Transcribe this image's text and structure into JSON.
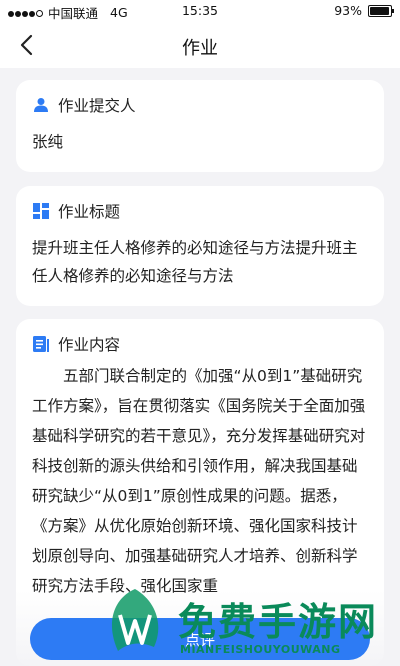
{
  "status_bar": {
    "carrier": "中国联通",
    "network": "4G",
    "time": "15:35",
    "battery": "93%",
    "battery_level": 0.93
  },
  "navbar": {
    "title": "作业",
    "back_icon": "chevron-left-icon"
  },
  "submitter": {
    "label": "作业提交人",
    "icon": "user-icon",
    "value": "张纯"
  },
  "homework_title": {
    "label": "作业标题",
    "icon": "grid-icon",
    "value": "提升班主任人格修养的必知途径与方法提升班主任人格修养的必知途径与方法"
  },
  "homework_content": {
    "label": "作业内容",
    "icon": "document-icon",
    "value": "五部门联合制定的《加强“从0到1”基础研究工作方案》，旨在贯彻落实《国务院关于全面加强基础科学研究的若干意见》，充分发挥基础研究对科技创新的源头供给和引领作用，解决我国基础研究缺少“从0到1”原创性成果的问题。据悉，《方案》从优化原始创新环境、强化国家科技计划原创导向、加强基础研究人才培养、创新科学研究方法手段、强化国家重"
  },
  "action": {
    "review_label": "点评"
  },
  "watermark": {
    "title": "免费手游网",
    "subtitle": "MIANFEISHOUYOUWANG"
  },
  "colors": {
    "primary": "#2d7bf4",
    "background": "#f3f3f6",
    "watermark_green": "#0a8a5a"
  }
}
